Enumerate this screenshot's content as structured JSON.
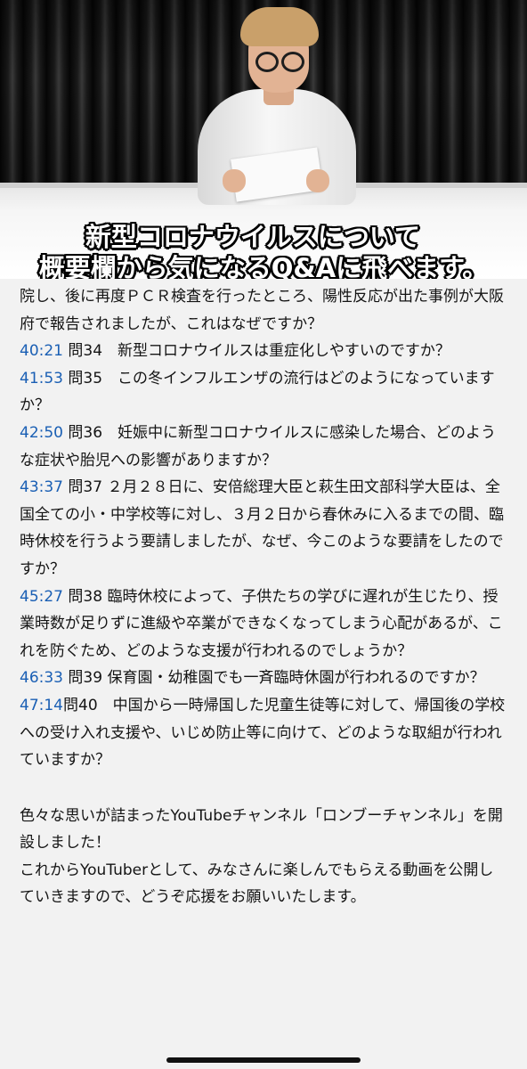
{
  "video": {
    "caption_line1": "新型コロナウイルスについて",
    "caption_line2": "概要欄から気になるQ&Aに飛べます。"
  },
  "description": {
    "intro": "院し、後に再度ＰＣＲ検査を行ったところ、陽性反応が出た事例が大阪府で報告されましたが、これはなぜですか？",
    "entries": [
      {
        "time": "40:21",
        "text": " 問34　新型コロナウイルスは重症化しやすいのですか？"
      },
      {
        "time": "41:53",
        "text": " 問35　この冬インフルエンザの流行はどのようになっていますか？"
      },
      {
        "time": "42:50",
        "text": " 問36　妊娠中に新型コロナウイルスに感染した場合、どのような症状や胎児への影響がありますか？"
      },
      {
        "time": "43:37",
        "text": " 問37 ２月２８日に、安倍総理大臣と萩生田文部科学大臣は、全国全ての小・中学校等に対し、３月２日から春休みに入るまでの間、臨時休校を行うよう要請しましたが、なぜ、今このような要請をしたのですか？"
      },
      {
        "time": "45:27",
        "text": " 問38 臨時休校によって、子供たちの学びに遅れが生じたり、授業時数が足りずに進級や卒業ができなくなってしまう心配があるが、これを防ぐため、どのような支援が行われるのでしょうか？"
      },
      {
        "time": "46:33",
        "text": " 問39 保育園・幼稚園でも一斉臨時休園が行われるのですか？"
      },
      {
        "time": "47:14",
        "text": "問40　中国から一時帰国した児童生徒等に対して、帰国後の学校への受け入れ支援や、いじめ防止等に向けて、どのような取組が行われていますか？"
      }
    ],
    "outro_1": "色々な思いが詰まったYouTubeチャンネル「ロンブーチャンネル」を開設しました！",
    "outro_2": "これからYouTuberとして、みなさんに楽しんでもらえる動画を公開していきますので、どうぞ応援をお願いいたします。"
  },
  "colors": {
    "timestamp": "#1a5fb4",
    "background": "#f2f2f2"
  }
}
